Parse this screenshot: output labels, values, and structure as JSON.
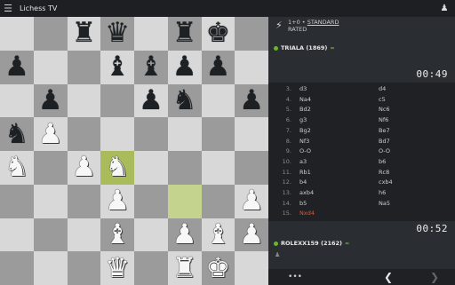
{
  "app": {
    "title": "Lichess TV"
  },
  "game": {
    "time_control": "1+0",
    "separator": " • ",
    "variant": "STANDARD",
    "rated": "RATED"
  },
  "players": {
    "top": {
      "name": "TRIALA (1869)",
      "clock": "00:49"
    },
    "bottom": {
      "name": "ROLEXX159 (2162)",
      "clock": "00:52"
    }
  },
  "moves": [
    {
      "n": "3.",
      "w": "d3",
      "b": "d4"
    },
    {
      "n": "4.",
      "w": "Na4",
      "b": "c5"
    },
    {
      "n": "5.",
      "w": "Bd2",
      "b": "Nc6"
    },
    {
      "n": "6.",
      "w": "g3",
      "b": "Nf6"
    },
    {
      "n": "7.",
      "w": "Bg2",
      "b": "Be7"
    },
    {
      "n": "8.",
      "w": "Nf3",
      "b": "Bd7"
    },
    {
      "n": "9.",
      "w": "O-O",
      "b": "O-O"
    },
    {
      "n": "10.",
      "w": "a3",
      "b": "b6"
    },
    {
      "n": "11.",
      "w": "Rb1",
      "b": "Rc8"
    },
    {
      "n": "12.",
      "w": "b4",
      "b": "cxb4"
    },
    {
      "n": "13.",
      "w": "axb4",
      "b": "h6"
    },
    {
      "n": "14.",
      "w": "b5",
      "b": "Na5"
    },
    {
      "n": "15.",
      "w": "Nxd4",
      "b": ""
    }
  ],
  "board": {
    "ranks": [
      [
        "",
        "",
        "bR",
        "bQ",
        "",
        "bR",
        "bK",
        ""
      ],
      [
        "bP",
        "",
        "",
        "bB",
        "bB",
        "bP",
        "bP",
        ""
      ],
      [
        "",
        "bP",
        "",
        "",
        "bP",
        "bN",
        "",
        "bP"
      ],
      [
        "bN",
        "wP",
        "",
        "",
        "",
        "",
        "",
        ""
      ],
      [
        "wN",
        "",
        "wP",
        "wN",
        "",
        "",
        "",
        ""
      ],
      [
        "",
        "",
        "",
        "wP",
        "",
        "",
        "",
        "wP"
      ],
      [
        "",
        "",
        "",
        "wB",
        "",
        "wP",
        "wB",
        "wP"
      ],
      [
        "",
        "",
        "",
        "wQ",
        "",
        "wR",
        "wK",
        ""
      ]
    ],
    "highlight": [
      "d4",
      "f3"
    ]
  },
  "icons": {
    "menu": "menu-icon",
    "tv": "tv-icon",
    "bolt": "bolt-icon",
    "more": "more-icon",
    "prev": "chevron-left-icon",
    "next": "chevron-right-icon"
  },
  "colors": {
    "board_light": "#d8d8d8",
    "board_dark": "#9b9b9b",
    "highlight": "#aabb5c",
    "online": "#6cb42d",
    "current_move": "#d85a3d"
  }
}
